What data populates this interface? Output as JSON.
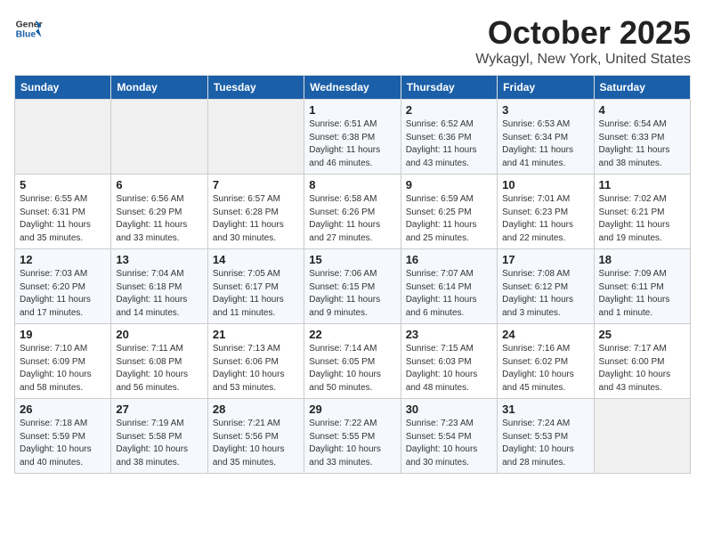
{
  "header": {
    "logo_general": "General",
    "logo_blue": "Blue",
    "title": "October 2025",
    "location": "Wykagyl, New York, United States"
  },
  "days_of_week": [
    "Sunday",
    "Monday",
    "Tuesday",
    "Wednesday",
    "Thursday",
    "Friday",
    "Saturday"
  ],
  "weeks": [
    [
      {
        "day": "",
        "detail": ""
      },
      {
        "day": "",
        "detail": ""
      },
      {
        "day": "",
        "detail": ""
      },
      {
        "day": "1",
        "detail": "Sunrise: 6:51 AM\nSunset: 6:38 PM\nDaylight: 11 hours and 46 minutes."
      },
      {
        "day": "2",
        "detail": "Sunrise: 6:52 AM\nSunset: 6:36 PM\nDaylight: 11 hours and 43 minutes."
      },
      {
        "day": "3",
        "detail": "Sunrise: 6:53 AM\nSunset: 6:34 PM\nDaylight: 11 hours and 41 minutes."
      },
      {
        "day": "4",
        "detail": "Sunrise: 6:54 AM\nSunset: 6:33 PM\nDaylight: 11 hours and 38 minutes."
      }
    ],
    [
      {
        "day": "5",
        "detail": "Sunrise: 6:55 AM\nSunset: 6:31 PM\nDaylight: 11 hours and 35 minutes."
      },
      {
        "day": "6",
        "detail": "Sunrise: 6:56 AM\nSunset: 6:29 PM\nDaylight: 11 hours and 33 minutes."
      },
      {
        "day": "7",
        "detail": "Sunrise: 6:57 AM\nSunset: 6:28 PM\nDaylight: 11 hours and 30 minutes."
      },
      {
        "day": "8",
        "detail": "Sunrise: 6:58 AM\nSunset: 6:26 PM\nDaylight: 11 hours and 27 minutes."
      },
      {
        "day": "9",
        "detail": "Sunrise: 6:59 AM\nSunset: 6:25 PM\nDaylight: 11 hours and 25 minutes."
      },
      {
        "day": "10",
        "detail": "Sunrise: 7:01 AM\nSunset: 6:23 PM\nDaylight: 11 hours and 22 minutes."
      },
      {
        "day": "11",
        "detail": "Sunrise: 7:02 AM\nSunset: 6:21 PM\nDaylight: 11 hours and 19 minutes."
      }
    ],
    [
      {
        "day": "12",
        "detail": "Sunrise: 7:03 AM\nSunset: 6:20 PM\nDaylight: 11 hours and 17 minutes."
      },
      {
        "day": "13",
        "detail": "Sunrise: 7:04 AM\nSunset: 6:18 PM\nDaylight: 11 hours and 14 minutes."
      },
      {
        "day": "14",
        "detail": "Sunrise: 7:05 AM\nSunset: 6:17 PM\nDaylight: 11 hours and 11 minutes."
      },
      {
        "day": "15",
        "detail": "Sunrise: 7:06 AM\nSunset: 6:15 PM\nDaylight: 11 hours and 9 minutes."
      },
      {
        "day": "16",
        "detail": "Sunrise: 7:07 AM\nSunset: 6:14 PM\nDaylight: 11 hours and 6 minutes."
      },
      {
        "day": "17",
        "detail": "Sunrise: 7:08 AM\nSunset: 6:12 PM\nDaylight: 11 hours and 3 minutes."
      },
      {
        "day": "18",
        "detail": "Sunrise: 7:09 AM\nSunset: 6:11 PM\nDaylight: 11 hours and 1 minute."
      }
    ],
    [
      {
        "day": "19",
        "detail": "Sunrise: 7:10 AM\nSunset: 6:09 PM\nDaylight: 10 hours and 58 minutes."
      },
      {
        "day": "20",
        "detail": "Sunrise: 7:11 AM\nSunset: 6:08 PM\nDaylight: 10 hours and 56 minutes."
      },
      {
        "day": "21",
        "detail": "Sunrise: 7:13 AM\nSunset: 6:06 PM\nDaylight: 10 hours and 53 minutes."
      },
      {
        "day": "22",
        "detail": "Sunrise: 7:14 AM\nSunset: 6:05 PM\nDaylight: 10 hours and 50 minutes."
      },
      {
        "day": "23",
        "detail": "Sunrise: 7:15 AM\nSunset: 6:03 PM\nDaylight: 10 hours and 48 minutes."
      },
      {
        "day": "24",
        "detail": "Sunrise: 7:16 AM\nSunset: 6:02 PM\nDaylight: 10 hours and 45 minutes."
      },
      {
        "day": "25",
        "detail": "Sunrise: 7:17 AM\nSunset: 6:00 PM\nDaylight: 10 hours and 43 minutes."
      }
    ],
    [
      {
        "day": "26",
        "detail": "Sunrise: 7:18 AM\nSunset: 5:59 PM\nDaylight: 10 hours and 40 minutes."
      },
      {
        "day": "27",
        "detail": "Sunrise: 7:19 AM\nSunset: 5:58 PM\nDaylight: 10 hours and 38 minutes."
      },
      {
        "day": "28",
        "detail": "Sunrise: 7:21 AM\nSunset: 5:56 PM\nDaylight: 10 hours and 35 minutes."
      },
      {
        "day": "29",
        "detail": "Sunrise: 7:22 AM\nSunset: 5:55 PM\nDaylight: 10 hours and 33 minutes."
      },
      {
        "day": "30",
        "detail": "Sunrise: 7:23 AM\nSunset: 5:54 PM\nDaylight: 10 hours and 30 minutes."
      },
      {
        "day": "31",
        "detail": "Sunrise: 7:24 AM\nSunset: 5:53 PM\nDaylight: 10 hours and 28 minutes."
      },
      {
        "day": "",
        "detail": ""
      }
    ]
  ]
}
